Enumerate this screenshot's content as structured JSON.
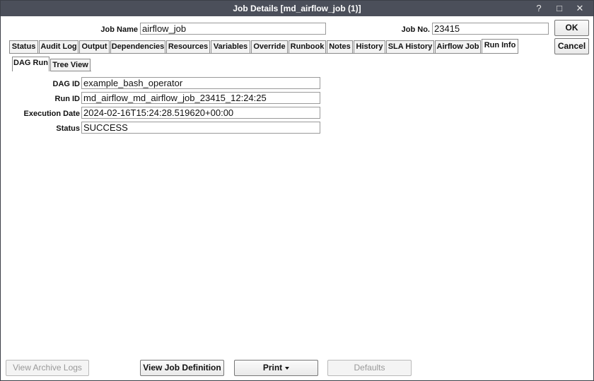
{
  "window": {
    "title": "Job Details [md_airflow_job (1)]",
    "help_glyph": "?",
    "maximize_glyph": "□",
    "close_glyph": "✕"
  },
  "header": {
    "job_name_label": "Job Name",
    "job_name_value": "airflow_job",
    "job_no_label": "Job No.",
    "job_no_value": "23415"
  },
  "buttons": {
    "ok": "OK",
    "cancel": "Cancel",
    "view_archive_logs": "View Archive Logs",
    "view_job_definition": "View Job Definition",
    "print": "Print",
    "defaults": "Defaults"
  },
  "tabs": [
    {
      "label": "Status"
    },
    {
      "label": "Audit Log"
    },
    {
      "label": "Output"
    },
    {
      "label": "Dependencies"
    },
    {
      "label": "Resources"
    },
    {
      "label": "Variables"
    },
    {
      "label": "Override"
    },
    {
      "label": "Runbook"
    },
    {
      "label": "Notes"
    },
    {
      "label": "History"
    },
    {
      "label": "SLA History"
    },
    {
      "label": "Airflow Job"
    },
    {
      "label": "Run Info"
    }
  ],
  "active_tab": "Run Info",
  "subtabs": [
    {
      "label": "DAG Run"
    },
    {
      "label": "Tree View"
    }
  ],
  "active_subtab": "DAG Run",
  "run_info": {
    "dag_id_label": "DAG ID",
    "dag_id_value": "example_bash_operator",
    "run_id_label": "Run ID",
    "run_id_value": "md_airflow_md_airflow_job_23415_12:24:25",
    "execution_date_label": "Execution Date",
    "execution_date_value": "2024-02-16T15:24:28.519620+00:00",
    "status_label": "Status",
    "status_value": "SUCCESS"
  },
  "colors": {
    "titlebar": "#4b4f5a",
    "border": "#3c3f47"
  }
}
